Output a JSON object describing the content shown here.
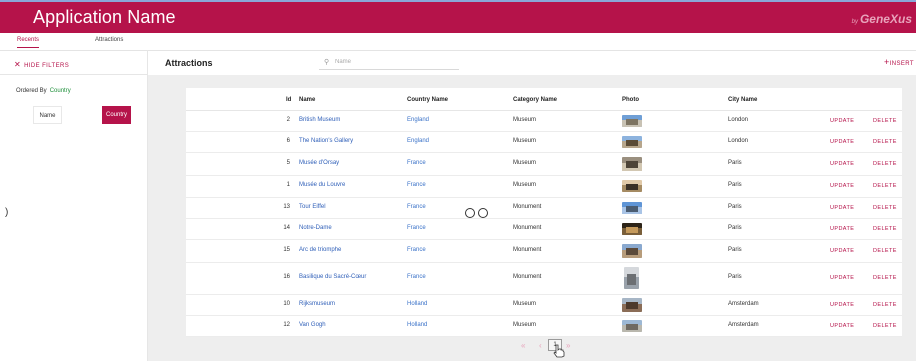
{
  "app": {
    "title": "Application Name",
    "brand_prefix": "by",
    "brand_name": "GeneXus"
  },
  "tabs": {
    "recents": "Recents",
    "attractions": "Attractions"
  },
  "filters": {
    "hide_label": "HIDE FILTERS",
    "ordered_by_label": "Ordered By",
    "ordered_by_value": "Country",
    "order_name": "Name",
    "order_country": "Country"
  },
  "main": {
    "title": "Attractions",
    "search_placeholder": "Name",
    "insert_label": "INSERT"
  },
  "grid": {
    "headers": {
      "id": "Id",
      "name": "Name",
      "country": "Country Name",
      "category": "Category Name",
      "photo": "Photo",
      "city": "City Name"
    },
    "action_update": "UPDATE",
    "action_delete": "DELETE",
    "rows": [
      {
        "id": "2",
        "name": "British Museum",
        "country": "England",
        "category": "Museum",
        "city": "London",
        "photo_icon": "british-museum-photo"
      },
      {
        "id": "6",
        "name": "The Nation's Gallery",
        "country": "England",
        "category": "Museum",
        "city": "London",
        "photo_icon": "national-gallery-photo"
      },
      {
        "id": "5",
        "name": "Musée d'Orsay",
        "country": "France",
        "category": "Museum",
        "city": "Paris",
        "photo_icon": "orsay-photo"
      },
      {
        "id": "1",
        "name": "Musée du Louvre",
        "country": "France",
        "category": "Museum",
        "city": "Paris",
        "photo_icon": "louvre-photo"
      },
      {
        "id": "13",
        "name": "Tour Eiffel",
        "country": "France",
        "category": "Monument",
        "city": "Paris",
        "photo_icon": "eiffel-photo"
      },
      {
        "id": "14",
        "name": "Notre-Dame",
        "country": "France",
        "category": "Monument",
        "city": "Paris",
        "photo_icon": "notre-dame-photo"
      },
      {
        "id": "15",
        "name": "Arc de triomphe",
        "country": "France",
        "category": "Monument",
        "city": "Paris",
        "photo_icon": "arc-photo"
      },
      {
        "id": "16",
        "name": "Basilique du Sacré-Cœur",
        "country": "France",
        "category": "Monument",
        "city": "Paris",
        "photo_icon": "sacre-coeur-photo"
      },
      {
        "id": "10",
        "name": "Rijksmuseum",
        "country": "Holland",
        "category": "Museum",
        "city": "Amsterdam",
        "photo_icon": "rijksmuseum-photo"
      },
      {
        "id": "12",
        "name": "Van Gogh",
        "country": "Holland",
        "category": "Museum",
        "city": "Amsterdam",
        "photo_icon": "van-gogh-photo"
      }
    ]
  },
  "pagination": {
    "first": "«",
    "prev": "‹",
    "current": "1",
    "next": "»"
  },
  "colors": {
    "accent": "#b5134a",
    "link": "#2f5fb8",
    "header_bg": "#b5134a"
  }
}
